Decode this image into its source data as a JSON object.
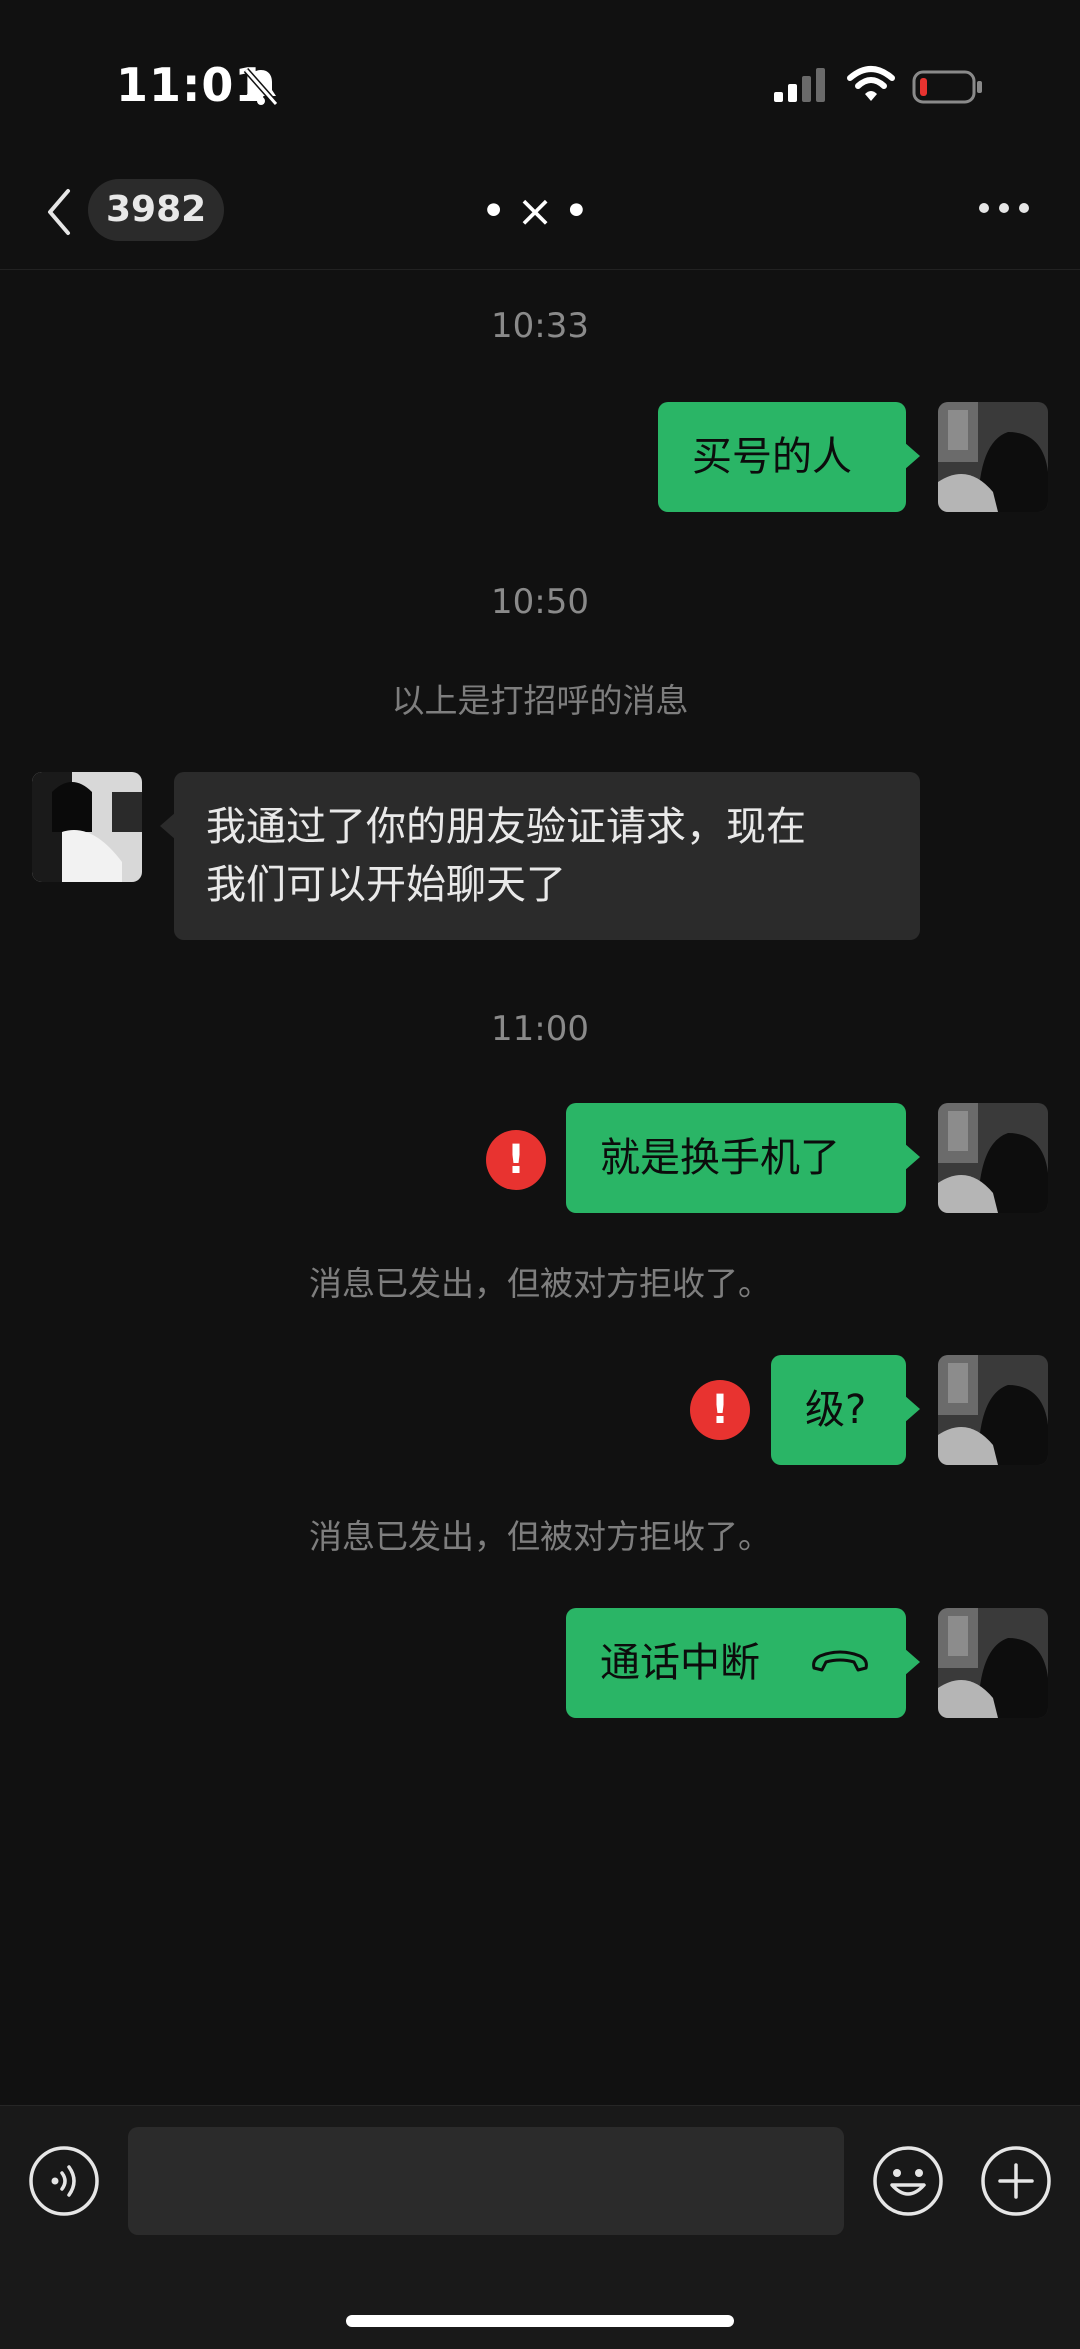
{
  "status_bar": {
    "time": "11:01",
    "icons": [
      "bell-muted-icon",
      "signal-icon",
      "wifi-icon",
      "battery-low-icon"
    ]
  },
  "nav": {
    "unread_count": "3982",
    "title": "•×•",
    "back_icon": "chevron-left-icon",
    "more_icon": "more-dots-icon"
  },
  "messages": {
    "ts1": "10:33",
    "msg1": "买号的人",
    "ts2": "10:50",
    "sys1": "以上是打招呼的消息",
    "msg2_line1": "我通过了你的朋友验证请求，现在",
    "msg2_line2": "我们可以开始聊天了",
    "ts3": "11:00",
    "msg3": "就是换手机了",
    "sys2": "消息已发出，但被对方拒收了。",
    "msg4": "级?",
    "sys3": "消息已发出，但被对方拒收了。",
    "msg5": "通话中断",
    "error_mark": "!"
  },
  "input_bar": {
    "icons": [
      "voice-icon",
      "emoji-icon",
      "plus-icon"
    ]
  },
  "colors": {
    "background": "#111111",
    "outgoing_bubble": "#2ab566",
    "incoming_bubble": "#2b2b2b",
    "error": "#e83330"
  }
}
